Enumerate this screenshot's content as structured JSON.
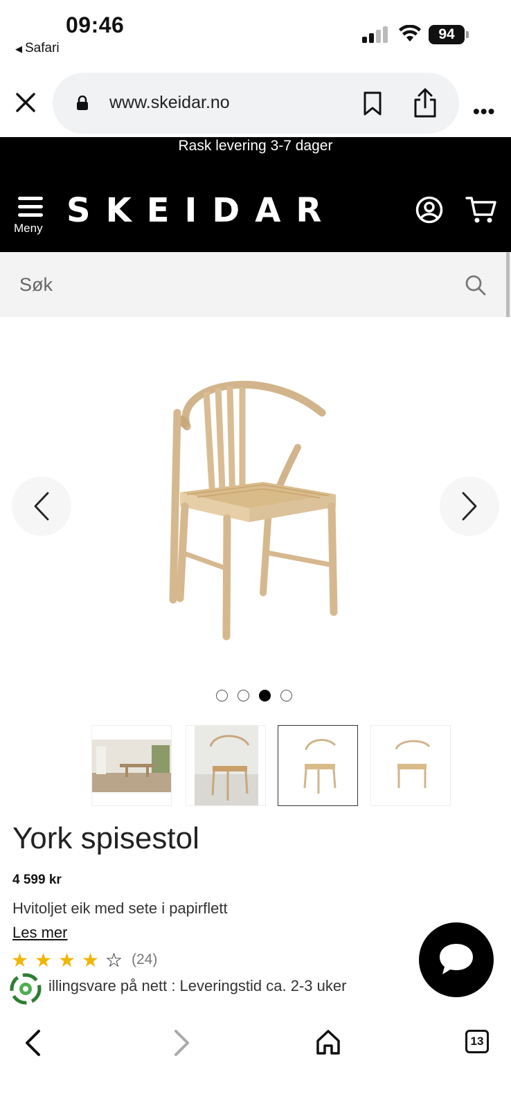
{
  "status_bar": {
    "time": "09:46",
    "back_app": "Safari",
    "battery": "94"
  },
  "browser": {
    "url": "www.skeidar.no",
    "more_label": "•••",
    "tab_count": "13"
  },
  "site": {
    "promo_text": "Rask levering 3-7 dager",
    "menu_label": "Meny",
    "logo_text": "SKEIDAR",
    "search_placeholder": "Søk"
  },
  "product": {
    "title": "York spisestol",
    "price": "4 599 kr",
    "description": "Hvitoljet eik med sete i papirflett",
    "read_more": "Les mer",
    "rating": 4,
    "rating_max": 5,
    "review_count": "(24)",
    "delivery_text": "illingsvare på nett : Leveringstid ca. 2-3 uker"
  },
  "carousel": {
    "image_count": 4,
    "active_index": 2
  },
  "icons": {
    "close": "close-icon",
    "lock": "lock-icon",
    "bookmark": "bookmark-icon",
    "share": "share-icon",
    "menu": "hamburger-icon",
    "account": "account-icon",
    "cart": "cart-icon",
    "search": "search-icon",
    "chat": "chat-bubble-icon",
    "back": "chevron-left-icon",
    "forward": "chevron-right-icon",
    "home": "home-icon",
    "tabs": "tabs-icon"
  },
  "colors": {
    "header_bg": "#000000",
    "star": "#f2b500",
    "search_bg": "#f3f3f3"
  }
}
